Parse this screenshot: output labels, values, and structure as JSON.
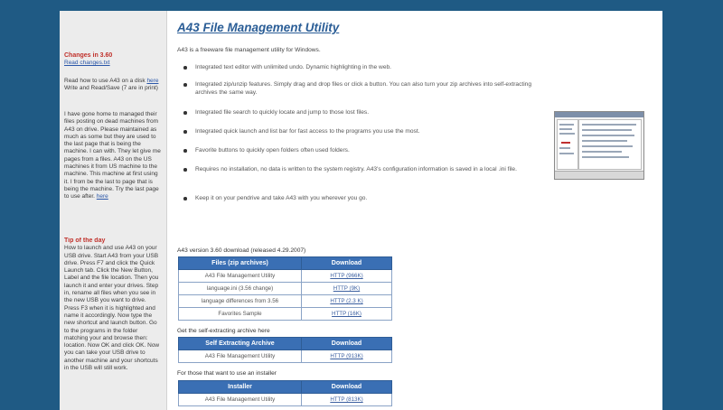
{
  "sidebar": {
    "changes_heading": "Changes in 3.60",
    "changes_link": "Read changes.txt",
    "para1": "Read how to use A43 on a disk",
    "para1_link": "here",
    "para1_rest": "Write and Read/Save (7 are in print)",
    "para2": "I have gone home to managed their files posting on dead machines from A43 on drive. Please maintained as much as some but they are used to the last page that is being the machine. I can with. They let give me pages from a files. A43 on the US machines it from US machine to the machine. This machine at first using it. I from be the last to page that is being the machine. Try the last page to use after.",
    "para2_link": "here",
    "tip_heading": "Tip of the day",
    "tip_text": "How to launch and use A43 on your USB drive. Start A43 from your USB drive. Press F7 and click the Quick Launch tab. Click the New Button, Label and the file location. Then you launch it and enter your drives. Step in, rename all files when you see in the new USB you want to drive. Press F3 when it is highlighted and name it accordingly. Now type the new shortcut and launch button. Go to the programs in the folder matching your and browse then: location. Now OK and click OK. Now you can take your USB drive to another machine and your shortcuts in the USB will still work."
  },
  "main": {
    "title": "A43 File Management Utility",
    "intro": "A43 is a freeware file management utility for Windows.",
    "bullets": [
      "Integrated text editor with unlimited undo. Dynamic highlighting in the web.",
      "Integrated zip/unzip features. Simply drag and drop files or click a button. You can also turn your zip archives into self-extracting archives the same way.",
      "Integrated file search to quickly locate and jump to those lost files.",
      "Integrated quick launch and list bar for fast access to the programs you use the most.",
      "Favorite buttons to quickly open folders often used folders.",
      "Requires no installation, no data is written to the system registry. A43's configuration information is saved in a local .ini file.",
      "Keep it on your pendrive and take A43 with you wherever you go."
    ],
    "section1_caption": "A43 version 3.60 download (released 4.29.2007)",
    "table1": {
      "headers": [
        "Files (zip archives)",
        "Download"
      ],
      "rows": [
        [
          "A43 File Management Utility",
          "HTTP (966K)"
        ],
        [
          "language.ini (3.56 change)",
          "HTTP (9K)"
        ],
        [
          "language differences from 3.56",
          "HTTP (2.3 K)"
        ],
        [
          "Favorites Sample",
          "HTTP (16K)"
        ]
      ]
    },
    "section2_caption": "Get the self-extracting archive here",
    "table2": {
      "headers": [
        "Self Extracting Archive",
        "Download"
      ],
      "rows": [
        [
          "A43 File Management Utility",
          "HTTP (913K)"
        ]
      ]
    },
    "section3_caption": "For those that want to use an installer",
    "table3": {
      "headers": [
        "Installer",
        "Download"
      ],
      "rows": [
        [
          "A43 File Management Utility",
          "HTTP (813K)"
        ]
      ]
    }
  },
  "colors": {
    "background": "#1f5a84",
    "table_header": "#3a6fb4",
    "title": "#2a5d96",
    "sidebar_heading": "#c0302a"
  }
}
